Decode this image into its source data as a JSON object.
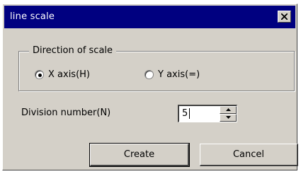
{
  "window": {
    "title": "line scale",
    "close_icon": "close-icon"
  },
  "direction_group": {
    "legend": "Direction of scale",
    "options": [
      {
        "label": "X axis(H)",
        "selected": true
      },
      {
        "label": "Y axis(=)",
        "selected": false
      }
    ]
  },
  "division": {
    "label": "Division number(N)",
    "value": "5",
    "up_icon": "spin-up-icon",
    "down_icon": "spin-down-icon"
  },
  "buttons": {
    "create_label": "Create",
    "cancel_label": "Cancel"
  },
  "colors": {
    "titlebar": "#000080",
    "face": "#d4d0c8"
  }
}
